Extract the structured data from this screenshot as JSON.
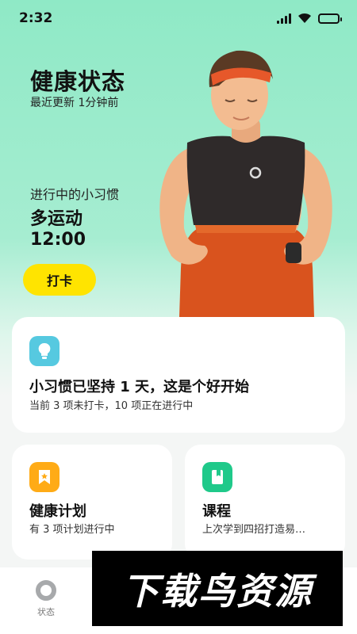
{
  "status_bar": {
    "time": "2:32",
    "icons": [
      "signal-icon",
      "wifi-icon",
      "battery-icon"
    ]
  },
  "header": {
    "title": "健康状态",
    "subtitle": "最近更新 1分钟前"
  },
  "habit": {
    "label": "进行中的小习惯",
    "name": "多运动",
    "time": "12:00",
    "checkin_label": "打卡"
  },
  "summary_card": {
    "icon": "lightbulb-icon",
    "title": "小习惯已坚持 1 天，这是个好开始",
    "desc": "当前 3 项未打卡，10 项正在进行中"
  },
  "plan_card": {
    "icon": "ribbon-icon",
    "title": "健康计划",
    "desc": "有 3 项计划进行中"
  },
  "course_card": {
    "icon": "book-icon",
    "title": "课程",
    "desc": "上次学到四招打造易…"
  },
  "bottom_nav": {
    "items": [
      {
        "label": "状态",
        "icon": "status-ring-icon"
      }
    ]
  },
  "watermark": {
    "text": "下载鸟资源"
  },
  "colors": {
    "hero_bg": "#8fe9c6",
    "checkin_button": "#ffe400",
    "summary_icon": "#56c9e0",
    "plan_icon": "#ffab16",
    "course_icon": "#1fc98a"
  }
}
